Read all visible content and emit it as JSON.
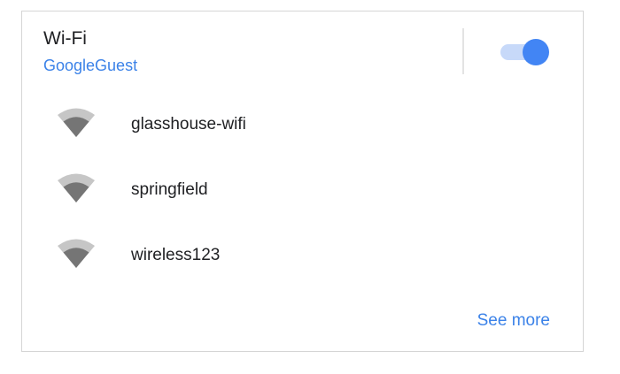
{
  "wifi_card": {
    "title": "Wi-Fi",
    "connected_network": "GoogleGuest",
    "toggle": {
      "enabled": true,
      "track_color": "#c7d9f9",
      "knob_color": "#4285f4"
    },
    "networks": [
      {
        "name": "glasshouse-wifi",
        "icon": "wifi-signal-icon"
      },
      {
        "name": "springfield",
        "icon": "wifi-signal-icon"
      },
      {
        "name": "wireless123",
        "icon": "wifi-signal-icon"
      }
    ],
    "see_more_label": "See more",
    "colors": {
      "accent": "#3b82e8",
      "icon_dark": "#757575",
      "icon_light": "#c6c6c6"
    }
  }
}
